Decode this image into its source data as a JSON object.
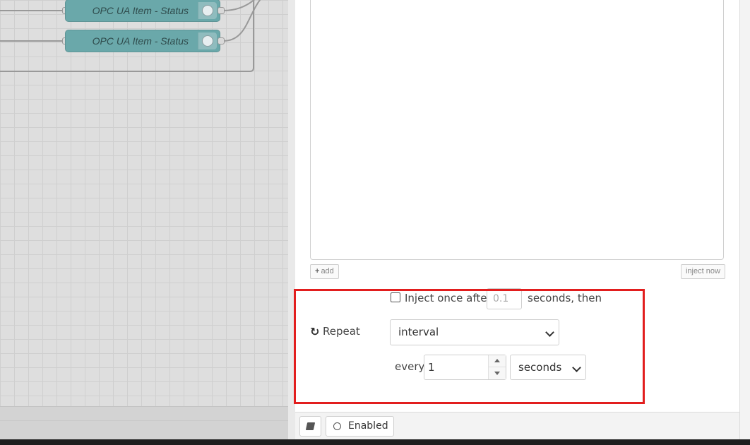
{
  "canvas": {
    "nodes": [
      {
        "label": "OPC UA Item - Status",
        "icon": "opcua-globe-icon"
      },
      {
        "label": "OPC UA Item - Status",
        "icon": "opcua-globe-icon"
      }
    ]
  },
  "tray": {
    "add_label": "add",
    "inject_now_label": "inject now",
    "inject_once": {
      "label": "Inject once after",
      "checked": false,
      "delay_placeholder": "0.1",
      "suffix": "seconds, then"
    },
    "repeat": {
      "icon": "repeat-icon",
      "label": "Repeat",
      "mode": "interval",
      "every_label": "every",
      "interval_value": "1",
      "units": "seconds"
    },
    "footer": {
      "docs_icon": "book-icon",
      "enabled_label": "Enabled"
    }
  },
  "colors": {
    "node_fill": "#6aa8aa",
    "highlight": "#e21e1e"
  }
}
